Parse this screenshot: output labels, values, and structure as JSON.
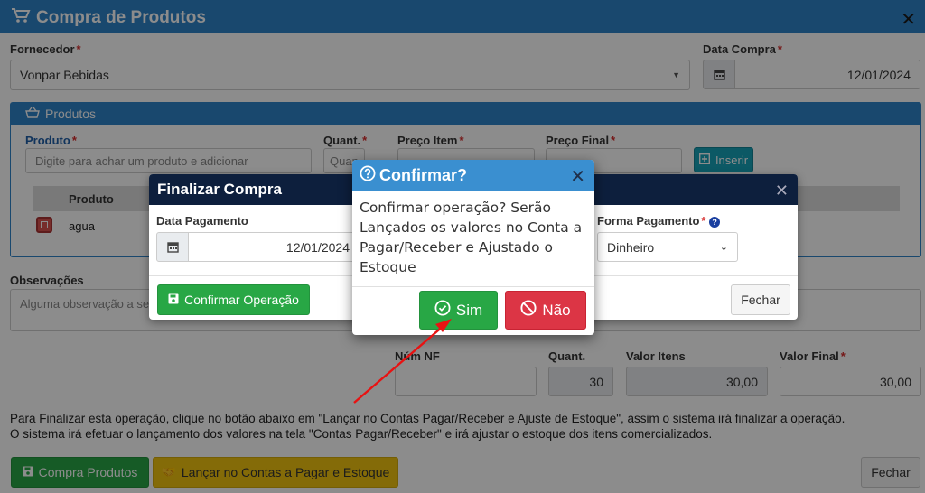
{
  "main": {
    "title": "Compra de Produtos",
    "fornecedor_label": "Fornecedor",
    "fornecedor_value": "Vonpar Bebidas",
    "data_compra_label": "Data Compra",
    "data_compra_value": "12/01/2024",
    "produtos_panel_title": "Produtos",
    "produto_label": "Produto",
    "produto_placeholder": "Digite para achar um produto e adicionar",
    "quant_label": "Quant.",
    "quant_placeholder": "Quan",
    "preco_item_label": "Preço Item",
    "preco_final_label": "Preço Final",
    "inserir_label": "Inserir",
    "table_header_produto": "Produto",
    "table_row_produto": "agua",
    "observacoes_label": "Observações",
    "observacoes_placeholder": "Alguma observação a ser f",
    "num_nf_label": "Núm NF",
    "quant_total_label": "Quant.",
    "quant_total_value": "30",
    "valor_itens_label": "Valor Itens",
    "valor_itens_value": "30,00",
    "valor_final_label": "Valor Final",
    "valor_final_value": "30,00",
    "note_line1": "Para Finalizar esta operação, clique no botão abaixo em \"Lançar no Contas Pagar/Receber e Ajuste de Estoque\", assim o sistema irá finalizar a operação.",
    "note_line2": "O sistema irá efetuar o lançamento dos valores na tela \"Contas Pagar/Receber\" e irá ajustar o estoque dos itens comercializados.",
    "compra_button": "Compra Produtos",
    "lancar_button": "Lançar no Contas a Pagar e Estoque",
    "fechar_button": "Fechar"
  },
  "finalizar": {
    "title": "Finalizar Compra",
    "data_pagamento_label": "Data Pagamento",
    "data_pagamento_value": "12/01/2024",
    "forma_pagamento_label": "Forma Pagamento",
    "forma_pagamento_value": "Dinheiro",
    "confirmar_button": "Confirmar Operação",
    "fechar_button": "Fechar"
  },
  "confirm": {
    "title": "Confirmar?",
    "message": "Confirmar operação? Serão Lançados os valores no Conta a Pagar/Receber e Ajustado o Estoque",
    "sim_button": "Sim",
    "nao_button": "Não"
  },
  "colors": {
    "header_blue": "#2f83c9",
    "dark_navy": "#0d1f3d",
    "success_green": "#28a745",
    "warning_yellow": "#f1c40f",
    "danger_red": "#dc3545",
    "arrow_red": "#e81212"
  }
}
